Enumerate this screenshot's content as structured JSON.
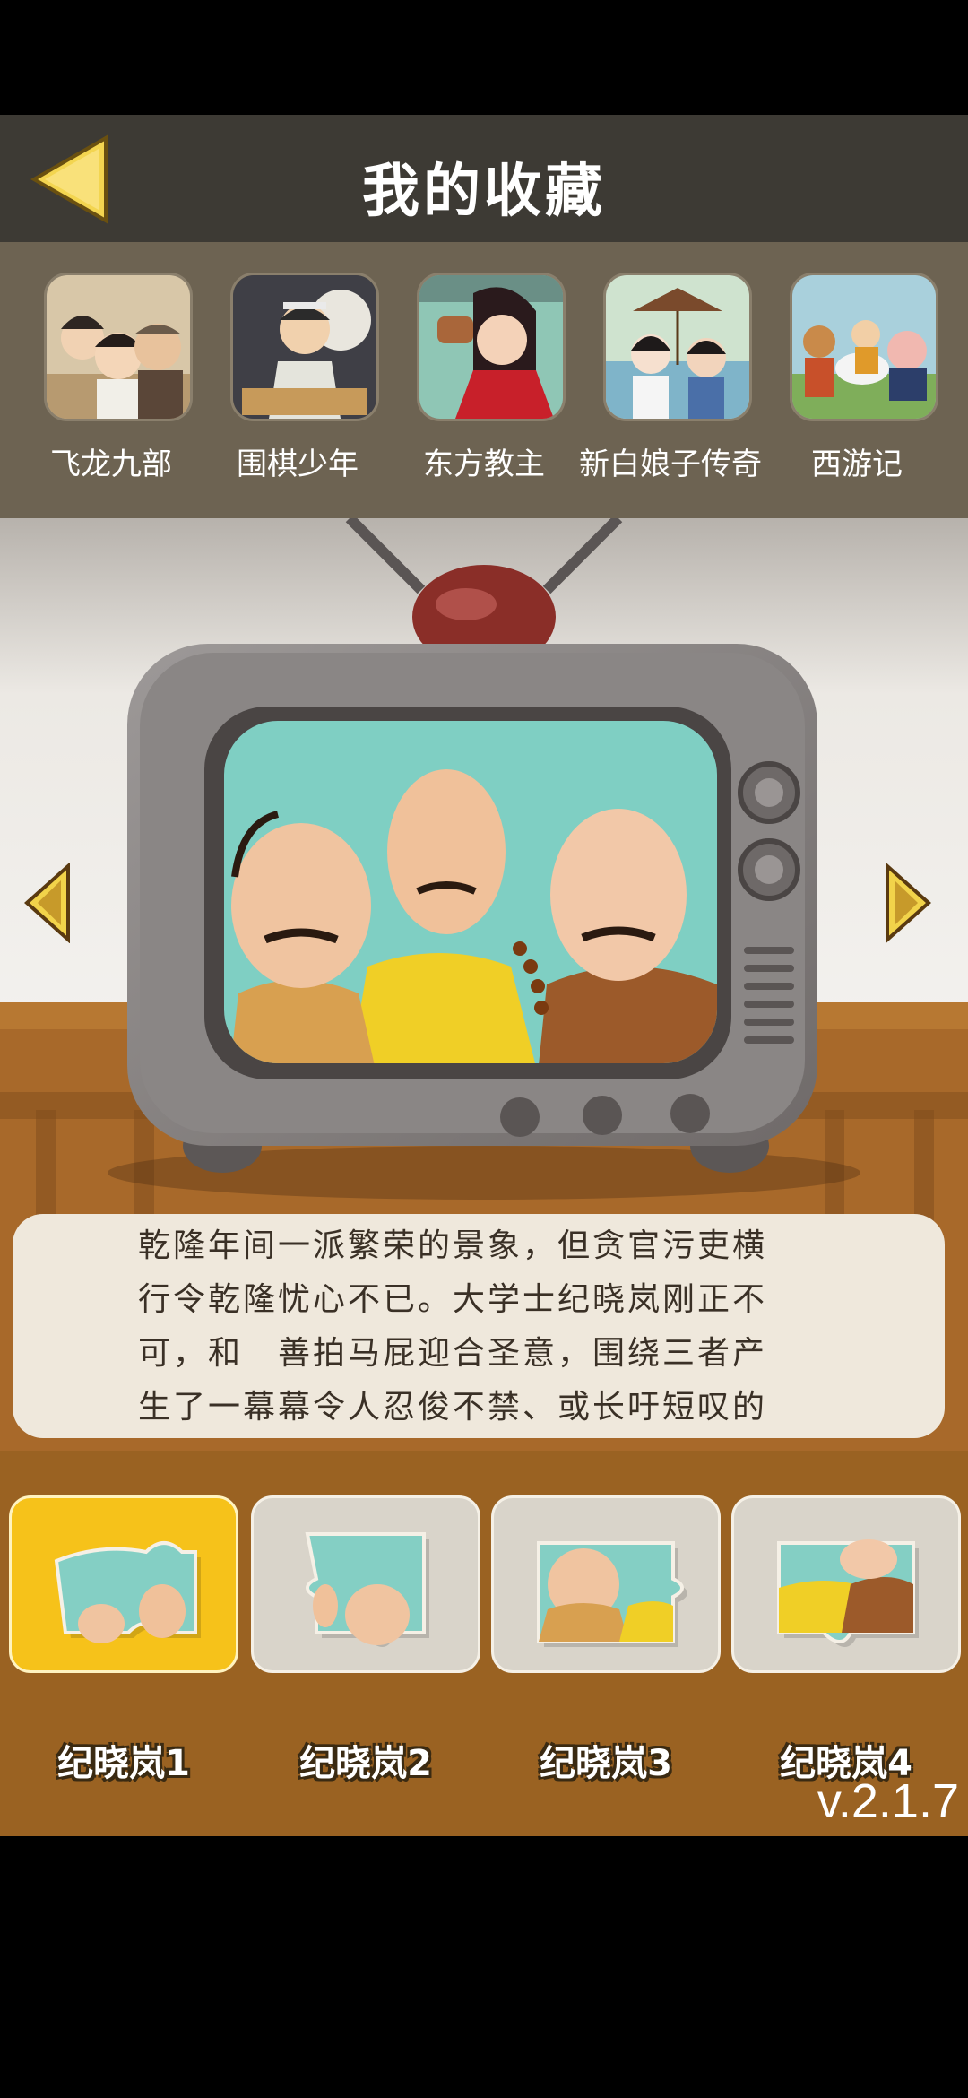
{
  "header": {
    "title": "我的收藏"
  },
  "favorites": [
    {
      "label": "飞龙九部"
    },
    {
      "label": "围棋少年"
    },
    {
      "label": "东方教主"
    },
    {
      "label": "新白娘子传奇"
    },
    {
      "label": "西游记"
    }
  ],
  "description": {
    "lines": [
      "乾隆年间一派繁荣的景象，但贪官污吏横",
      "行令乾隆忧心不已。大学士纪晓岚刚正不",
      "可，和　善拍马屁迎合圣意，围绕三者产",
      "生了一幕幕令人忍俊不禁、或长吁短叹的"
    ]
  },
  "pieces": [
    {
      "label": "纪晓岚1",
      "selected": true
    },
    {
      "label": "纪晓岚2",
      "selected": false
    },
    {
      "label": "纪晓岚3",
      "selected": false
    },
    {
      "label": "纪晓岚4",
      "selected": false
    }
  ],
  "version": "v.2.1.7",
  "colors": {
    "header": "#3d3a34",
    "strip": "#6d6352",
    "bottom": "#9a6222",
    "selected": "#f6c21a",
    "arrow": "#f2d34a"
  }
}
